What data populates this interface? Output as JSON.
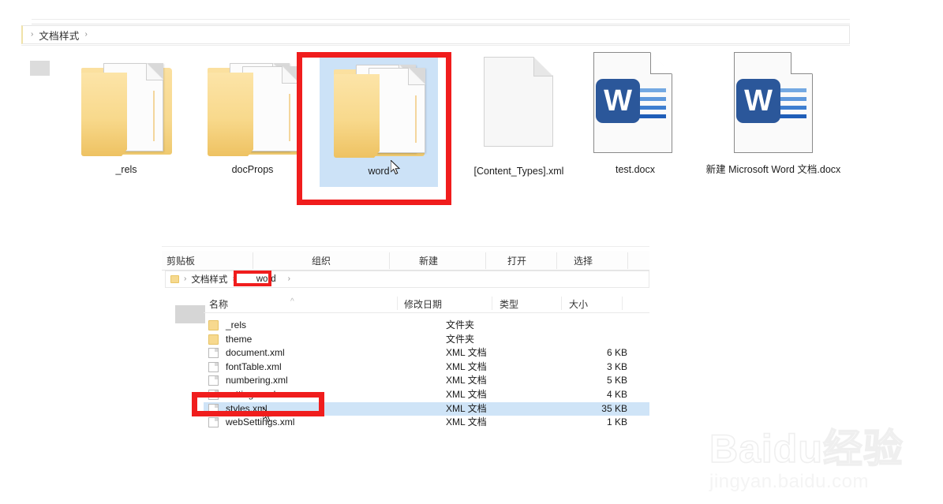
{
  "top_window": {
    "breadcrumb": {
      "sep": "›",
      "path_label": "文档样式",
      "trailing_sep": "›"
    },
    "items": [
      {
        "name": "_rels",
        "kind": "folder",
        "selected": false
      },
      {
        "name": "docProps",
        "kind": "folder-multi",
        "selected": false
      },
      {
        "name": "word",
        "kind": "folder-multi",
        "selected": true
      },
      {
        "name": "[Content_Types].xml",
        "kind": "xml-blank",
        "selected": false
      },
      {
        "name": "test.docx",
        "kind": "word",
        "selected": false
      },
      {
        "name": "新建 Microsoft Word 文档.docx",
        "kind": "word",
        "selected": false
      }
    ]
  },
  "bottom_window": {
    "ribbon_groups": [
      "剪贴板",
      "组织",
      "新建",
      "打开",
      "选择"
    ],
    "breadcrumb": {
      "sep": "›",
      "parent": "文档样式",
      "current": "word",
      "trailing_sep": "›"
    },
    "columns": [
      "名称",
      "修改日期",
      "类型",
      "大小"
    ],
    "rows": [
      {
        "name": "_rels",
        "icon": "folder",
        "type": "文件夹",
        "size": "",
        "selected": false
      },
      {
        "name": "theme",
        "icon": "folder",
        "type": "文件夹",
        "size": "",
        "selected": false
      },
      {
        "name": "document.xml",
        "icon": "file",
        "type": "XML 文档",
        "size": "6 KB",
        "selected": false
      },
      {
        "name": "fontTable.xml",
        "icon": "file",
        "type": "XML 文档",
        "size": "3 KB",
        "selected": false
      },
      {
        "name": "numbering.xml",
        "icon": "file",
        "type": "XML 文档",
        "size": "5 KB",
        "selected": false
      },
      {
        "name": "settings.xml",
        "icon": "file",
        "type": "XML 文档",
        "size": "4 KB",
        "selected": false
      },
      {
        "name": "styles.xml",
        "icon": "file",
        "type": "XML 文档",
        "size": "35 KB",
        "selected": true
      },
      {
        "name": "webSettings.xml",
        "icon": "file",
        "type": "XML 文档",
        "size": "1 KB",
        "selected": false
      }
    ]
  },
  "annotations": {
    "word_folder_box": "red-highlight-rectangle",
    "word_crumb_box": "red-highlight-rectangle",
    "styles_row_box": "red-highlight-rectangle"
  },
  "watermark": {
    "main": "Baidu经验",
    "sub": "jingyan.baidu.com"
  },
  "colors": {
    "selection_blue": "#cce2f7",
    "row_selection_blue": "#cfe4f7",
    "annotation_red": "#f01d1d",
    "folder_yellow": "#f7d98f",
    "word_blue": "#2b579a"
  }
}
